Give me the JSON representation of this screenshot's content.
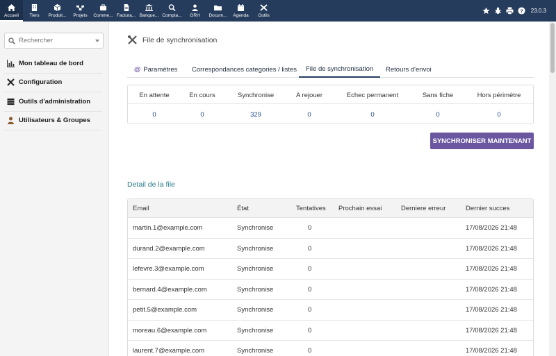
{
  "topnav": {
    "items": [
      {
        "label": "Accueil",
        "icon": "home-icon"
      },
      {
        "label": "Tiers",
        "icon": "building-icon"
      },
      {
        "label": "Produit...",
        "icon": "cube-icon"
      },
      {
        "label": "Projets",
        "icon": "sitemap-icon"
      },
      {
        "label": "Comme...",
        "icon": "suitcase-icon"
      },
      {
        "label": "Factura...",
        "icon": "file-icon"
      },
      {
        "label": "Banque...",
        "icon": "bank-icon"
      },
      {
        "label": "Compta...",
        "icon": "search-dollar-icon"
      },
      {
        "label": "GRH",
        "icon": "users-icon"
      },
      {
        "label": "Docum...",
        "icon": "folder-icon"
      },
      {
        "label": "Agenda",
        "icon": "calendar-icon"
      },
      {
        "label": "Outils",
        "icon": "tools-icon"
      }
    ],
    "version": "23.0.3"
  },
  "sidebar": {
    "search_placeholder": "Rechercher",
    "items": [
      {
        "label": "Mon tableau de bord",
        "icon": "chart-icon"
      },
      {
        "label": "Configuration",
        "icon": "tools-icon"
      },
      {
        "label": "Outils d'administration",
        "icon": "server-icon"
      },
      {
        "label": "Utilisateurs & Groupes",
        "icon": "user-icon"
      }
    ]
  },
  "page": {
    "title": "File de synchronisation",
    "tabs": [
      {
        "label": "Paramètres",
        "prefix": "@"
      },
      {
        "label": "Correspondances categories / listes"
      },
      {
        "label": "File de synchronisation"
      },
      {
        "label": "Retours d'envoi"
      }
    ],
    "active_tab": 2
  },
  "stats": [
    {
      "label": "En attente",
      "value": "0"
    },
    {
      "label": "En cours",
      "value": "0"
    },
    {
      "label": "Synchronise",
      "value": "329"
    },
    {
      "label": "A rejouer",
      "value": "0"
    },
    {
      "label": "Echec permanent",
      "value": "0"
    },
    {
      "label": "Sans fiche",
      "value": "0"
    },
    {
      "label": "Hors périmètre",
      "value": "0"
    }
  ],
  "sync_button": "SYNCHRONISER MAINTENANT",
  "queue": {
    "title": "Detail de la file",
    "columns": [
      "Email",
      "État",
      "Tentatives",
      "Prochain essai",
      "Derniere erreur",
      "Dernier succes"
    ],
    "rows": [
      [
        "martin.1@example.com",
        "Synchronise",
        "0",
        "",
        "",
        "17/08/2026 21:48"
      ],
      [
        "durand.2@example.com",
        "Synchronise",
        "0",
        "",
        "",
        "17/08/2026 21:48"
      ],
      [
        "lefevre.3@example.com",
        "Synchronise",
        "0",
        "",
        "",
        "17/08/2026 21:48"
      ],
      [
        "bernard.4@example.com",
        "Synchronise",
        "0",
        "",
        "",
        "17/08/2026 21:48"
      ],
      [
        "petit.5@example.com",
        "Synchronise",
        "0",
        "",
        "",
        "17/08/2026 21:48"
      ],
      [
        "moreau.6@example.com",
        "Synchronise",
        "0",
        "",
        "",
        "17/08/2026 21:48"
      ],
      [
        "laurent.7@example.com",
        "Synchronise",
        "0",
        "",
        "",
        "17/08/2026 21:48"
      ]
    ]
  },
  "colors": {
    "topbar": "#263c5c",
    "accent_button": "#6b56a0",
    "section_title": "#2a7c8a",
    "stat_value": "#1e4a8a"
  }
}
